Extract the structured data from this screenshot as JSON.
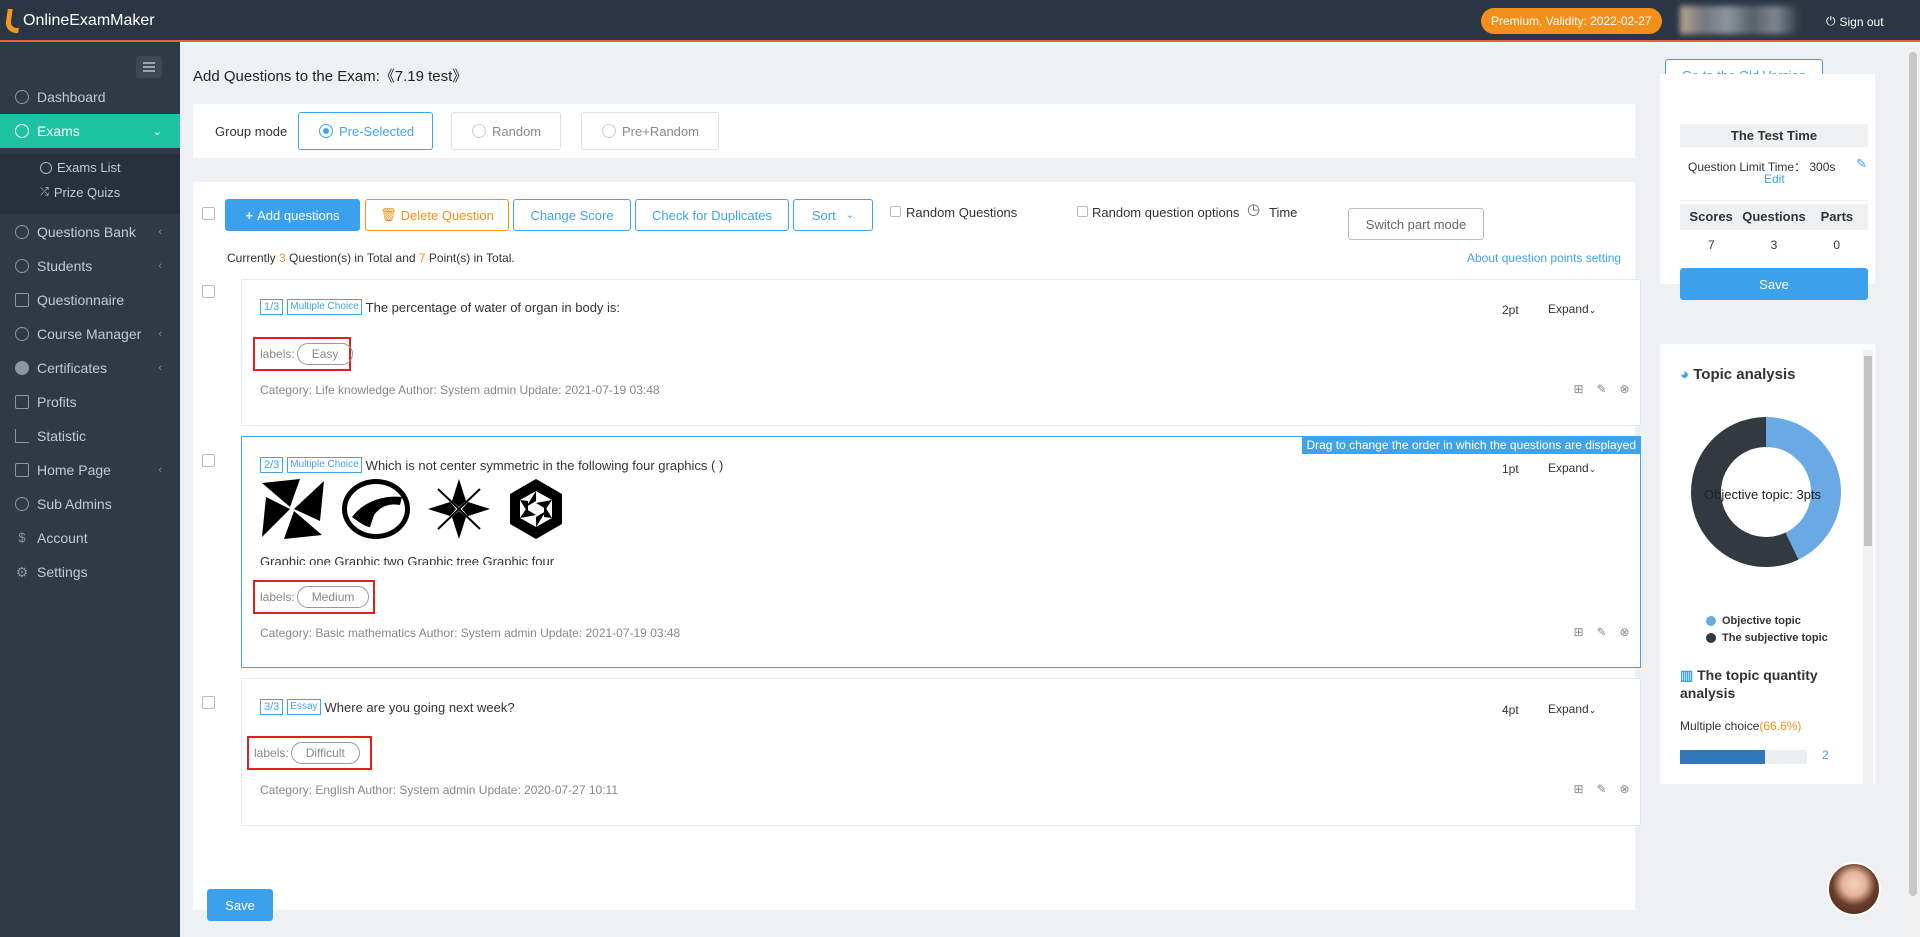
{
  "header": {
    "logo": "OnlineExamMaker",
    "premium": "Premium, Validity: 2022-02-27",
    "signout": "Sign out"
  },
  "sidebar": {
    "items": [
      {
        "label": "Dashboard",
        "icon": "home-icon"
      },
      {
        "label": "Exams",
        "icon": "check-circle-icon"
      },
      {
        "label": "Questions Bank",
        "icon": "question-icon"
      },
      {
        "label": "Students",
        "icon": "user-icon"
      },
      {
        "label": "Questionnaire",
        "icon": "checkbox-icon"
      },
      {
        "label": "Course Manager",
        "icon": "bookmark-icon"
      },
      {
        "label": "Certificates",
        "icon": "certificate-icon"
      },
      {
        "label": "Profits",
        "icon": "card-icon"
      },
      {
        "label": "Statistic",
        "icon": "bar-chart-icon"
      },
      {
        "label": "Home Page",
        "icon": "house-icon"
      },
      {
        "label": "Sub Admins",
        "icon": "question-icon"
      },
      {
        "label": "Account",
        "icon": "dollar-icon"
      },
      {
        "label": "Settings",
        "icon": "gear-icon"
      }
    ],
    "sub": [
      "Exams List",
      "Prize Quizs"
    ]
  },
  "main": {
    "title": "Add Questions to the Exam:《7.19 test》",
    "old_version": "Go to the Old Version",
    "group_mode": "Group mode",
    "modes": [
      "Pre-Selected",
      "Random",
      "Pre+Random"
    ],
    "toolbar": {
      "add": "Add questions",
      "delete": "Delete Question",
      "score": "Change Score",
      "dup": "Check for Duplicates",
      "sort": "Sort",
      "random_q": "Random Questions",
      "random_opt": "Random question options",
      "time": "Time",
      "switch": "Switch part mode"
    },
    "summary": {
      "pre": "Currently ",
      "count": "3",
      "mid": " Question(s) in Total and ",
      "points": "7",
      "post": " Point(s) in Total."
    },
    "about_points": "About question points setting",
    "drag_tip": "Drag to change the order in which the questions are displayed",
    "questions": [
      {
        "num": "1/3",
        "type": "Multiple Choice",
        "text": "The percentage of water of organ in body is:",
        "pts": "2pt",
        "expand": "Expand",
        "labels_prefix": "labels:",
        "label": "Easy",
        "meta": "Category: Life knowledge   Author: System admin   Update: 2021-07-19 03:48"
      },
      {
        "num": "2/3",
        "type": "Multiple Choice",
        "text": "Which is not center symmetric in the following four graphics ( )",
        "pts": "1pt",
        "expand": "Expand",
        "labels_prefix": "labels:",
        "label": "Medium",
        "caption": "Graphic one Graphic two Graphic tree Graphic four",
        "meta": "Category: Basic mathematics   Author: System admin   Update: 2021-07-19 03:48"
      },
      {
        "num": "3/3",
        "type": "Essay",
        "text": "Where are you going next week?",
        "pts": "4pt",
        "expand": "Expand",
        "labels_prefix": "labels:",
        "label": "Difficult",
        "meta": "Category: English   Author: System admin   Update: 2020-07-27 10:11"
      }
    ],
    "save": "Save"
  },
  "right": {
    "test_time_title": "The Test Time",
    "limit": "Question Limit Time： 300s",
    "edit": "Edit",
    "headers": [
      "Scores",
      "Questions",
      "Parts"
    ],
    "values": [
      "7",
      "3",
      "0"
    ],
    "save": "Save",
    "topic_title": "Topic analysis",
    "donut_label": "Objective topic: 3pts",
    "legend": [
      "Objective topic",
      "The subjective topic"
    ],
    "qty_title": "The topic quantity analysis",
    "mc_label": "Multiple choice",
    "mc_pct": "(66.6%)",
    "mc_count": "2"
  },
  "chart_data": {
    "type": "pie",
    "categories": [
      "Objective topic",
      "The subjective topic"
    ],
    "values": [
      3,
      4
    ],
    "colors": [
      "#6aa9e3",
      "#333940"
    ]
  }
}
